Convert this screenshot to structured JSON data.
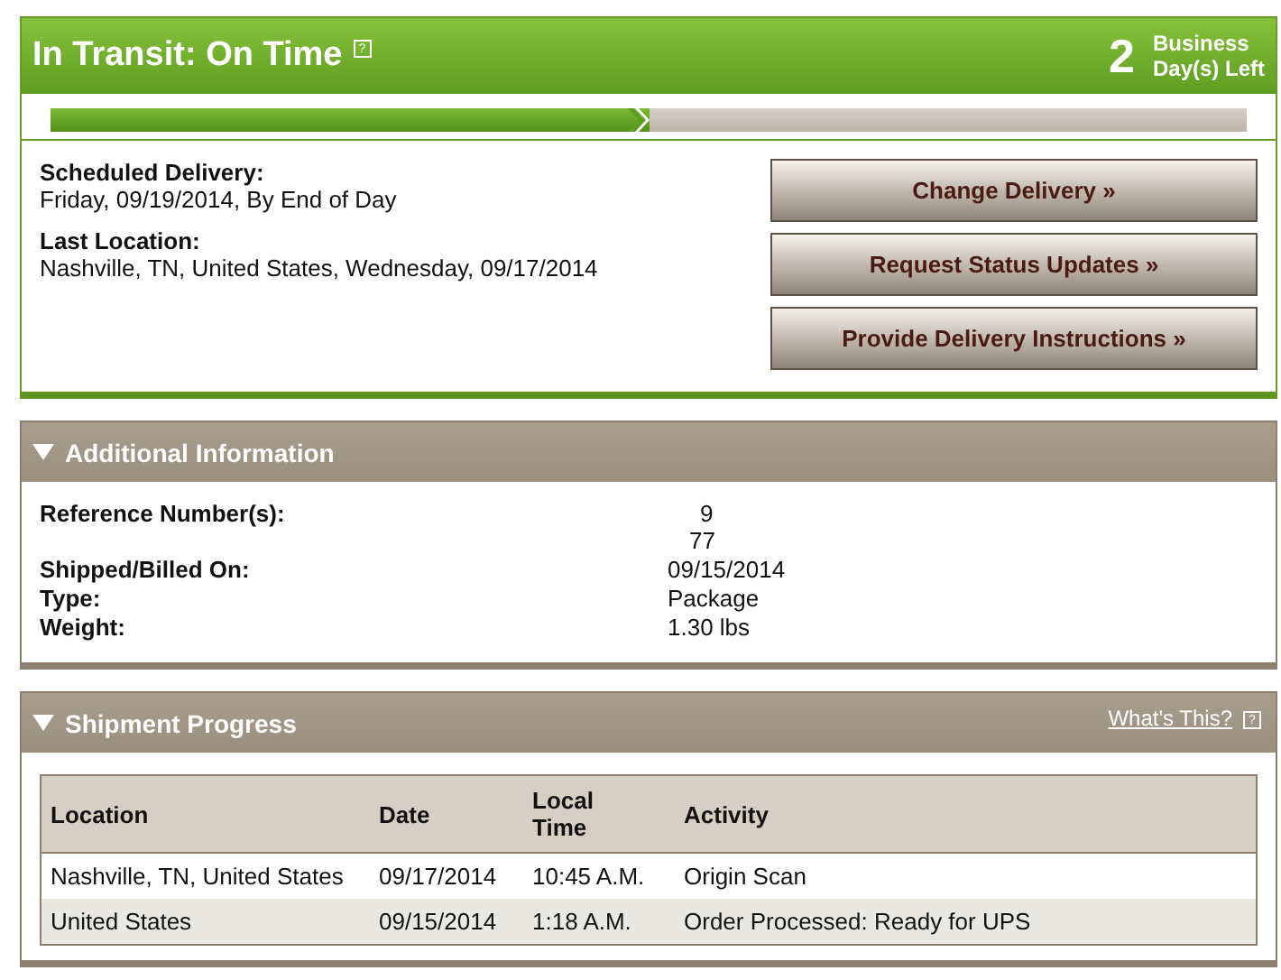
{
  "status": {
    "title": "In Transit: On Time",
    "help": "?",
    "days": "2",
    "days_label_1": "Business",
    "days_label_2": "Day(s) Left",
    "progress": {
      "level": 0.5
    }
  },
  "delivery": [
    {
      "label": "Scheduled Delivery:",
      "value": "Friday, 09/19/2014, By End of Day"
    },
    {
      "label": "Last Location:",
      "value": "Nashville, TN, United States, Wednesday, 09/17/2014"
    }
  ],
  "buttons": [
    "Change Delivery »",
    "Request Status Updates »",
    "Provide Delivery Instructions »"
  ],
  "additional": {
    "title": "Additional Information",
    "expanded": true,
    "rows": [
      {
        "label": "Reference Number(s):",
        "values": [
          "9",
          "77"
        ]
      },
      {
        "label": "Shipped/Billed On:",
        "values": [
          "09/15/2014"
        ]
      },
      {
        "label": "Type:",
        "values": [
          "Package"
        ]
      },
      {
        "label": "Weight:",
        "values": [
          "1.30 lbs"
        ]
      }
    ]
  },
  "progress": {
    "title": "Shipment Progress",
    "expanded": true,
    "link": "What's This?",
    "help": "?",
    "columns": [
      "Location",
      "Date",
      "Local Time",
      "Activity"
    ],
    "rows": [
      {
        "cells": [
          "Nashville, TN, United States",
          "09/17/2014",
          "10:45 A.M.",
          "Origin Scan"
        ]
      },
      {
        "cells": [
          "United States",
          "09/15/2014",
          "1:18 A.M.",
          "Order Processed: Ready for UPS"
        ]
      }
    ]
  }
}
